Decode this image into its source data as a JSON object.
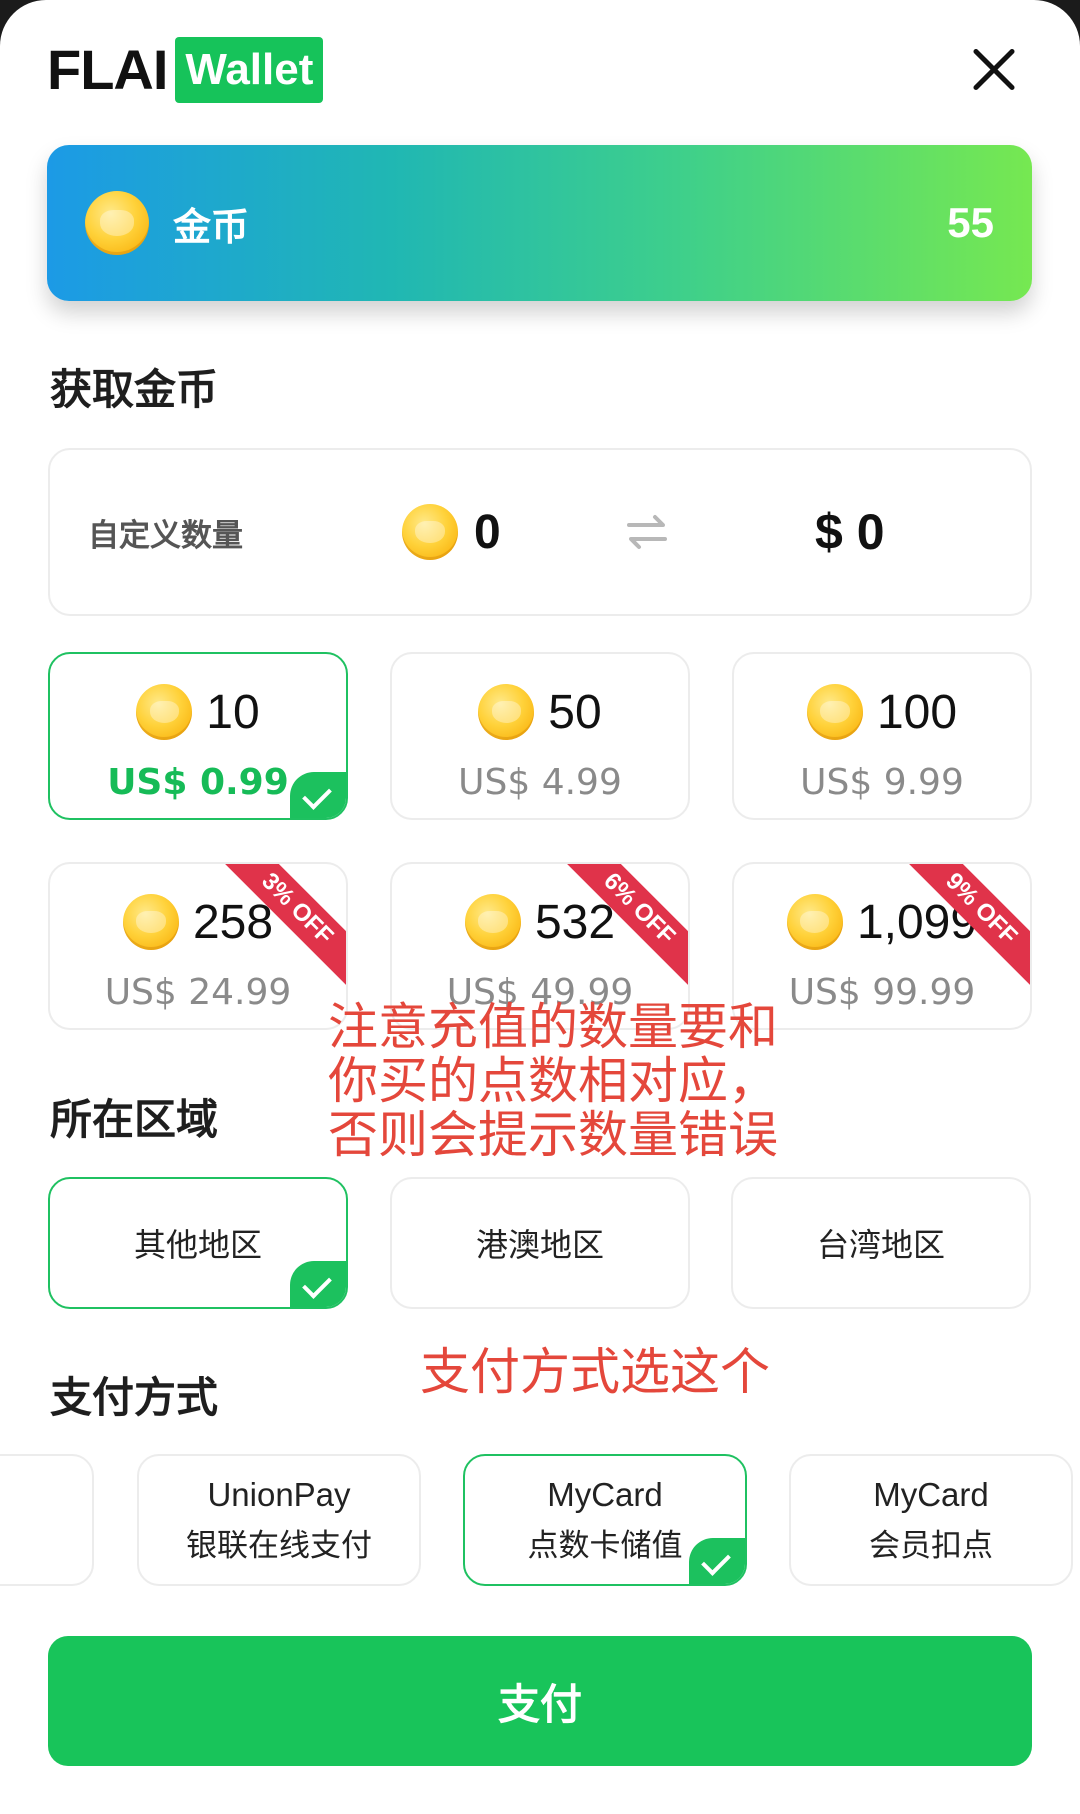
{
  "header": {
    "logo_part1": "FLAI",
    "logo_part2": "Wallet"
  },
  "balance": {
    "label": "金币",
    "value": "55"
  },
  "get_coins": {
    "title": "获取金币",
    "custom": {
      "label": "自定义数量",
      "quantity": "0",
      "price": "$ 0"
    },
    "packages": [
      {
        "amount": "10",
        "price": "US$ 0.99",
        "selected": true,
        "discount": ""
      },
      {
        "amount": "50",
        "price": "US$ 4.99",
        "selected": false,
        "discount": ""
      },
      {
        "amount": "100",
        "price": "US$ 9.99",
        "selected": false,
        "discount": ""
      },
      {
        "amount": "258",
        "price": "US$ 24.99",
        "selected": false,
        "discount": "3% OFF"
      },
      {
        "amount": "532",
        "price": "US$ 49.99",
        "selected": false,
        "discount": "6% OFF"
      },
      {
        "amount": "1,099",
        "price": "US$ 99.99",
        "selected": false,
        "discount": "9% OFF"
      }
    ]
  },
  "region": {
    "title": "所在区域",
    "options": [
      {
        "label": "其他地区",
        "selected": true
      },
      {
        "label": "港澳地区",
        "selected": false
      },
      {
        "label": "台湾地区",
        "selected": false
      }
    ]
  },
  "payment": {
    "title": "支付方式",
    "methods": [
      {
        "line1": "UnionPay",
        "line2": "银联在线支付",
        "selected": false
      },
      {
        "line1": "MyCard",
        "line2": "点数卡储值",
        "selected": true
      },
      {
        "line1": "MyCard",
        "line2": "会员扣点",
        "selected": false
      }
    ],
    "pay_button": "支付"
  },
  "annotations": {
    "note1_line1": "注意充值的数量要和",
    "note1_line2": "你买的点数相对应，",
    "note1_line3": "否则会提示数量错误",
    "note2": "支付方式选这个"
  },
  "colors": {
    "accent_green": "#18c45a",
    "discount_red": "#e0334a",
    "annotation_red": "#e4473b"
  }
}
